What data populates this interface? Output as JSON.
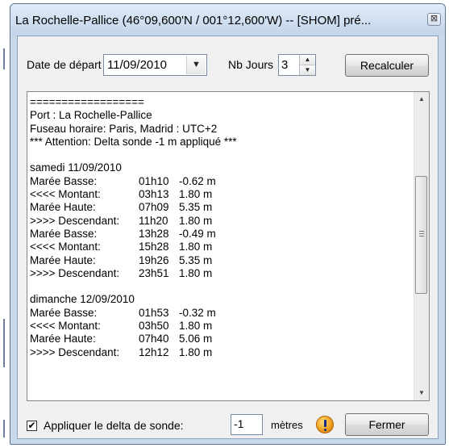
{
  "window": {
    "title": "La Rochelle-Pallice (46°09,600'N / 001°12,600'W) -- [SHOM] pré...",
    "close_glyph": "⊠"
  },
  "controls": {
    "date_label": "Date de départ",
    "date_value": "11/09/2010",
    "dropdown_arrow": "▼",
    "nbjours_label": "Nb Jours",
    "nbjours_value": "3",
    "spin_up": "▲",
    "spin_down": "▼",
    "recalc_label": "Recalculer"
  },
  "report": {
    "header": [
      "==================",
      "Port : La Rochelle-Pallice",
      "Fuseau horaire: Paris, Madrid : UTC+2",
      "*** Attention: Delta sonde -1 m appliqué ***"
    ],
    "days": [
      {
        "title": "samedi 11/09/2010",
        "rows": [
          {
            "event": "Marée Basse:",
            "time": "01h10",
            "height": "-0.62 m"
          },
          {
            "event": "<<<< Montant:",
            "time": "03h13",
            "height": "1.80 m"
          },
          {
            "event": "Marée Haute:",
            "time": "07h09",
            "height": "5.35 m"
          },
          {
            "event": ">>>> Descendant:",
            "time": "11h20",
            "height": "1.80 m"
          },
          {
            "event": "Marée Basse:",
            "time": "13h28",
            "height": "-0.49 m"
          },
          {
            "event": "<<<< Montant:",
            "time": "15h28",
            "height": "1.80 m"
          },
          {
            "event": "Marée Haute:",
            "time": "19h26",
            "height": "5.35 m"
          },
          {
            "event": ">>>> Descendant:",
            "time": "23h51",
            "height": "1.80 m"
          }
        ]
      },
      {
        "title": "dimanche 12/09/2010",
        "rows": [
          {
            "event": "Marée Basse:",
            "time": "01h53",
            "height": "-0.32 m"
          },
          {
            "event": "<<<< Montant:",
            "time": "03h50",
            "height": "1.80 m"
          },
          {
            "event": "Marée Haute:",
            "time": "07h40",
            "height": "5.06 m"
          },
          {
            "event": ">>>> Descendant:",
            "time": "12h12",
            "height": "1.80 m"
          }
        ]
      }
    ],
    "scroll_up": "▲",
    "scroll_down": "▼"
  },
  "footer": {
    "checkbox_checked": "✔",
    "checkbox_label": "Appliquer le delta de sonde:",
    "delta_value": "-1",
    "unit_label": "mètres",
    "icon": "warning-icon",
    "close_label": "Fermer"
  }
}
